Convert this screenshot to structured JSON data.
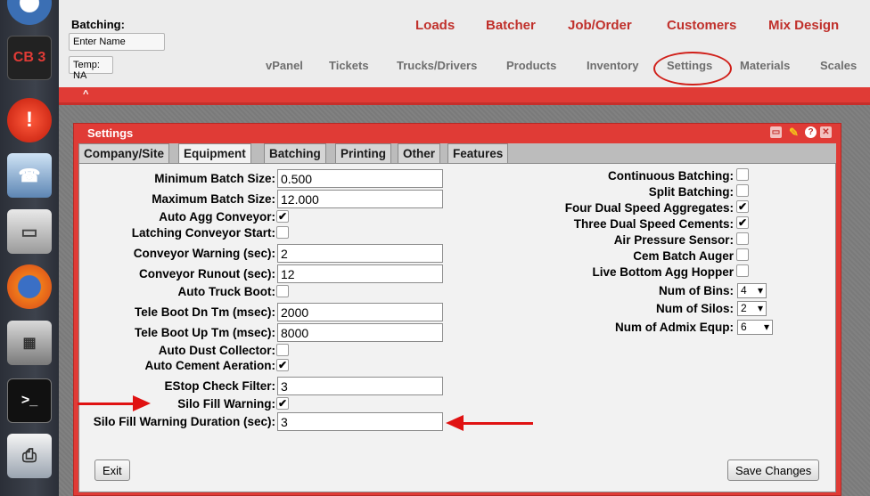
{
  "dock": {
    "items": [
      {
        "name": "app-menu-icon"
      },
      {
        "name": "cb3-app-icon",
        "label": "CB 3"
      },
      {
        "name": "alert-icon"
      },
      {
        "name": "fax-machine-icon"
      },
      {
        "name": "file-cabinet-icon"
      },
      {
        "name": "firefox-icon"
      },
      {
        "name": "calculator-icon"
      },
      {
        "name": "terminal-icon"
      },
      {
        "name": "printer-icon"
      }
    ]
  },
  "header": {
    "batching_label": "Batching:",
    "name_value": "Enter Name",
    "temp_value": "Temp: NA",
    "main_nav": [
      "Loads",
      "Batcher",
      "Job/Order",
      "Customers",
      "Mix Design"
    ],
    "sub_nav": [
      "vPanel",
      "Tickets",
      "Trucks/Drivers",
      "Products",
      "Inventory",
      "Settings",
      "Materials",
      "Scales"
    ]
  },
  "window": {
    "title": "Settings",
    "tabs": [
      "Company/Site",
      "Equipment",
      "Batching",
      "Printing",
      "Other",
      "Features"
    ],
    "active_tab": "Equipment"
  },
  "equipment": {
    "left": {
      "min_batch_size": {
        "label": "Minimum Batch Size:",
        "value": "0.500"
      },
      "max_batch_size": {
        "label": "Maximum Batch Size:",
        "value": "12.000"
      },
      "auto_agg_conveyor": {
        "label": "Auto Agg Conveyor:",
        "checked": true
      },
      "latching_conveyor_start": {
        "label": "Latching Conveyor Start:",
        "checked": false
      },
      "conveyor_warning": {
        "label": "Conveyor Warning (sec):",
        "value": "2"
      },
      "conveyor_runout": {
        "label": "Conveyor Runout (sec):",
        "value": "12"
      },
      "auto_truck_boot": {
        "label": "Auto Truck Boot:",
        "checked": false
      },
      "tele_boot_dn": {
        "label": "Tele Boot Dn Tm (msec):",
        "value": "2000"
      },
      "tele_boot_up": {
        "label": "Tele Boot Up Tm (msec):",
        "value": "8000"
      },
      "auto_dust_collector": {
        "label": "Auto Dust Collector:",
        "checked": false
      },
      "auto_cement_aeration": {
        "label": "Auto Cement Aeration:",
        "checked": true
      },
      "estop_check_filter": {
        "label": "EStop Check Filter:",
        "value": "3"
      },
      "silo_fill_warning": {
        "label": "Silo Fill Warning:",
        "checked": true
      },
      "silo_fill_warning_duration": {
        "label": "Silo Fill Warning Duration (sec):",
        "value": "3"
      }
    },
    "right": {
      "continuous_batching": {
        "label": "Continuous Batching:",
        "checked": false
      },
      "split_batching": {
        "label": "Split Batching:",
        "checked": false
      },
      "four_dual_speed_aggregates": {
        "label": "Four Dual Speed Aggregates:",
        "checked": true
      },
      "three_dual_speed_cements": {
        "label": "Three Dual Speed Cements:",
        "checked": true
      },
      "air_pressure_sensor": {
        "label": "Air Pressure Sensor:",
        "checked": false
      },
      "cem_batch_auger": {
        "label": "Cem Batch Auger",
        "checked": false
      },
      "live_bottom_agg_hopper": {
        "label": "Live Bottom Agg Hopper",
        "checked": false
      },
      "num_of_bins": {
        "label": "Num of Bins:",
        "value": "4"
      },
      "num_of_silos": {
        "label": "Num of Silos:",
        "value": "2"
      },
      "num_of_admix_equip": {
        "label": "Num of Admix Equp:",
        "value": "6"
      }
    }
  },
  "buttons": {
    "exit": "Exit",
    "save": "Save Changes"
  },
  "glyphs": {
    "check": "✔",
    "dropdown": "▾",
    "collapse": "^"
  },
  "colors": {
    "accent_red": "#e03b36",
    "nav_red": "#c0302b",
    "annotation_red": "#e01212"
  }
}
